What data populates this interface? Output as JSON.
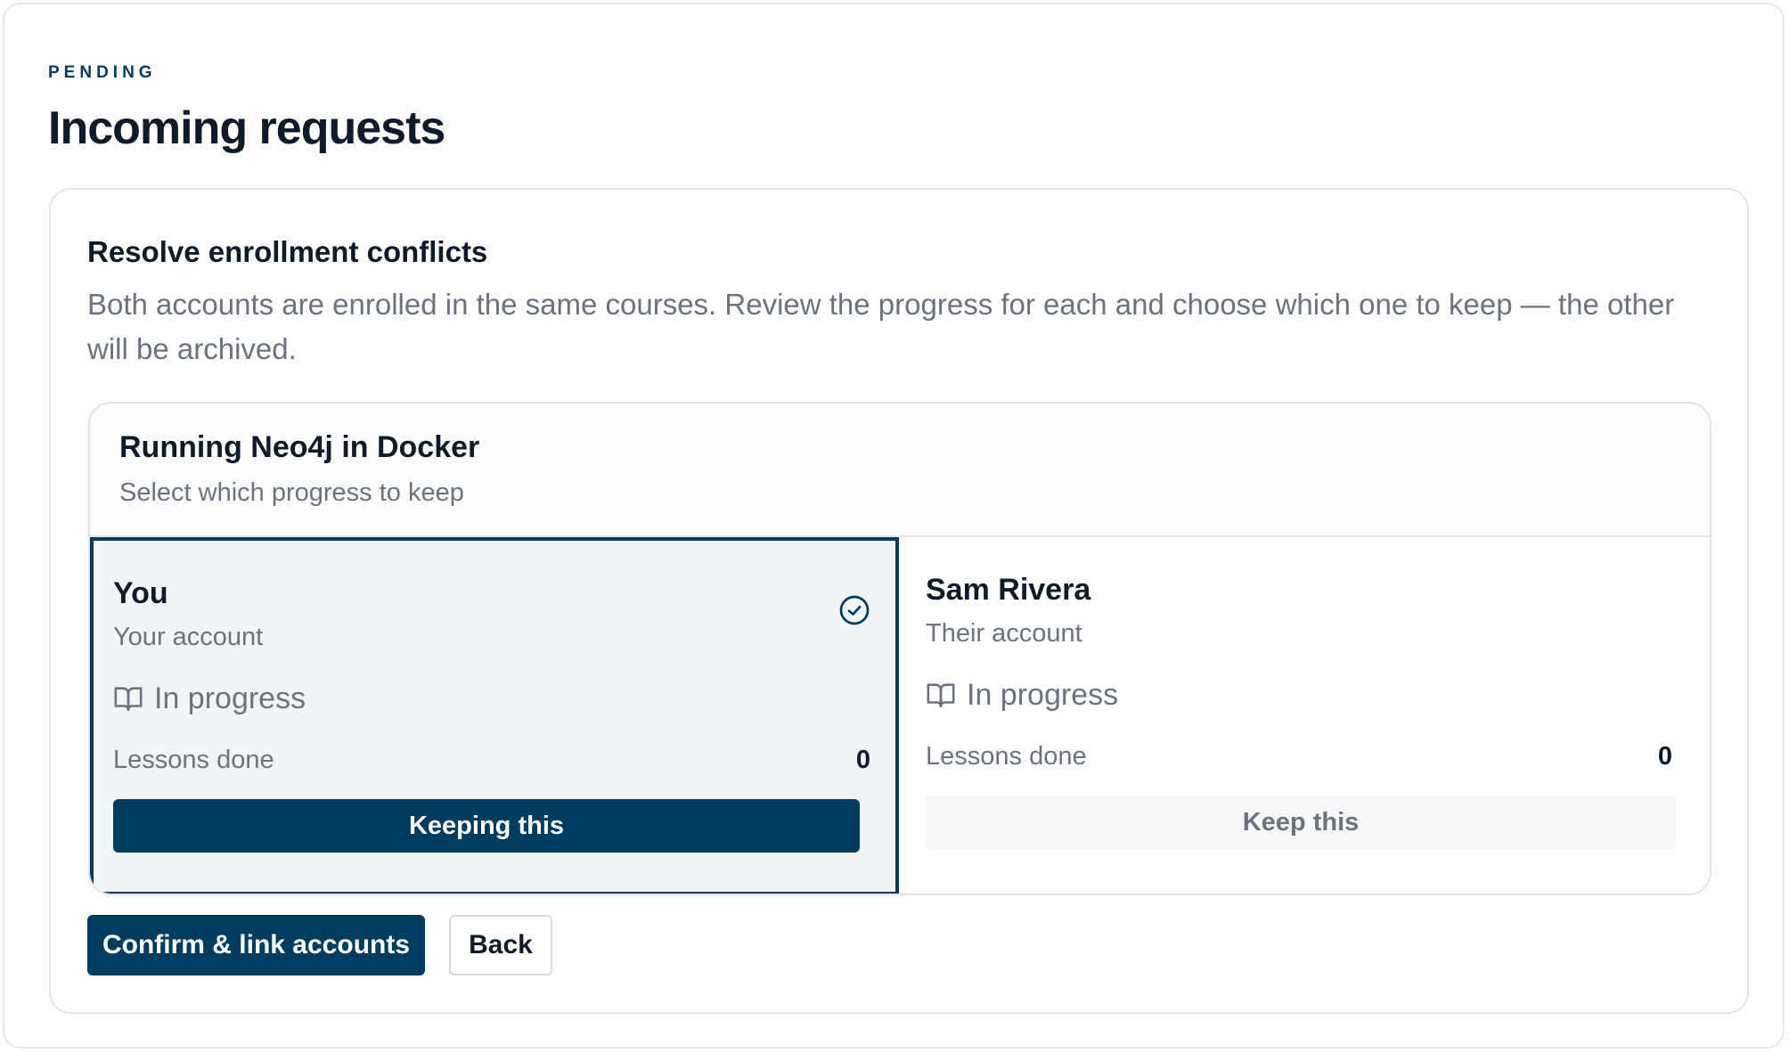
{
  "header": {
    "eyebrow": "PENDING",
    "title": "Incoming requests"
  },
  "panel": {
    "title": "Resolve enrollment conflicts",
    "description": "Both accounts are enrolled in the same courses. Review the progress for each and choose which one to keep — the other will be archived."
  },
  "course": {
    "title": "Running Neo4j in Docker",
    "subtitle": "Select which progress to keep",
    "options": [
      {
        "name": "You",
        "role": "Your account",
        "status": "In progress",
        "lessons_label": "Lessons done",
        "lessons_value": "0",
        "button_label": "Keeping this",
        "selected": true
      },
      {
        "name": "Sam Rivera",
        "role": "Their account",
        "status": "In progress",
        "lessons_label": "Lessons done",
        "lessons_value": "0",
        "button_label": "Keep this",
        "selected": false
      }
    ]
  },
  "actions": {
    "confirm_label": "Confirm & link accounts",
    "back_label": "Back"
  },
  "colors": {
    "brand": "#003c5e",
    "text": "#0d1b2a",
    "muted": "#6b7280",
    "selected_bg": "#f1f5f8"
  },
  "icons": {
    "status": "book-open-icon",
    "selected": "check-circle-icon"
  }
}
